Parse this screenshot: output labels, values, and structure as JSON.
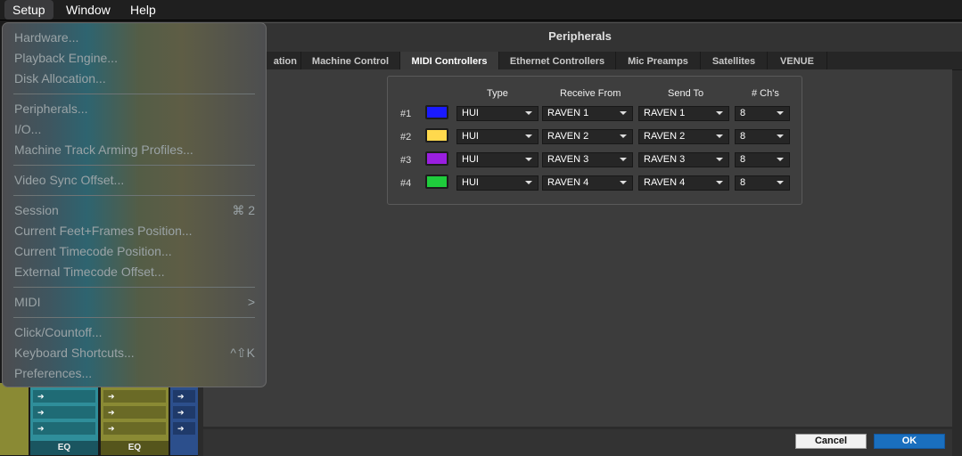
{
  "menubar": {
    "items": [
      "Setup",
      "Window",
      "Help"
    ]
  },
  "setup_menu": {
    "group1": [
      "Hardware...",
      "Playback Engine...",
      "Disk Allocation..."
    ],
    "group2": [
      "Peripherals...",
      "I/O...",
      "Machine Track Arming Profiles..."
    ],
    "group3": [
      "Video Sync Offset..."
    ],
    "group4": [
      "Session",
      "Current Feet+Frames Position...",
      "Current Timecode Position...",
      "External Timecode Offset..."
    ],
    "session_shortcut": "⌘ 2",
    "midi": "MIDI",
    "midi_arrow": ">",
    "group5": [
      "Click/Countoff...",
      "Keyboard Shortcuts...",
      "Preferences..."
    ],
    "keyboard_shortcut": "^⇧K"
  },
  "window": {
    "title": "Peripherals",
    "tabs": [
      "ation",
      "Machine Control",
      "MIDI Controllers",
      "Ethernet Controllers",
      "Mic Preamps",
      "Satellites",
      "VENUE"
    ],
    "selected_tab": "MIDI Controllers",
    "columns": [
      "Type",
      "Receive From",
      "Send To",
      "# Ch's"
    ],
    "rows": [
      {
        "label": "#1",
        "color": "#1a1aff",
        "type": "HUI",
        "receive": "RAVEN 1",
        "send": "RAVEN 1",
        "channels": "8"
      },
      {
        "label": "#2",
        "color": "#ffd94d",
        "type": "HUI",
        "receive": "RAVEN 2",
        "send": "RAVEN 2",
        "channels": "8"
      },
      {
        "label": "#3",
        "color": "#9a1fe0",
        "type": "HUI",
        "receive": "RAVEN 3",
        "send": "RAVEN 3",
        "channels": "8"
      },
      {
        "label": "#4",
        "color": "#1fcc3c",
        "type": "HUI",
        "receive": "RAVEN 4",
        "send": "RAVEN 4",
        "channels": "8"
      }
    ],
    "buttons": {
      "cancel": "Cancel",
      "ok": "OK"
    }
  },
  "mixer": {
    "eq_label": "EQ",
    "strip_colors": [
      "#8a8a34",
      "#2f8e9a",
      "#8a8a34",
      "#2c4f8c"
    ]
  }
}
